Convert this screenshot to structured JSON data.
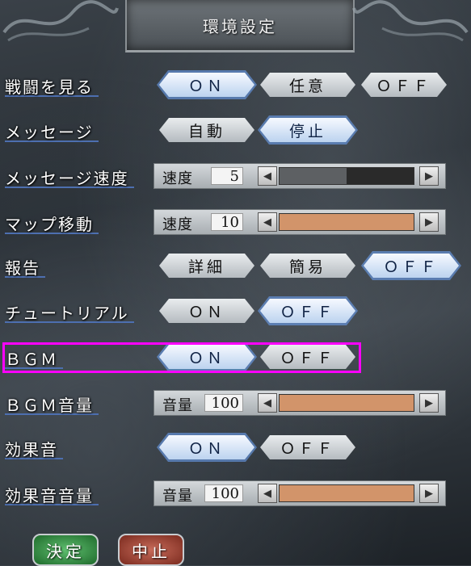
{
  "title": "環境設定",
  "colors": {
    "highlight": "#ff00ff",
    "slider_fill": "#d2946a",
    "slider_gray": "#5d6063"
  },
  "rows": [
    {
      "label": "戦闘を見る",
      "options": [
        "ＯＮ",
        "任意",
        "ＯＦＦ"
      ],
      "selected": 0
    },
    {
      "label": "メッセージ",
      "options": [
        "自動",
        "停止"
      ],
      "selected": 1
    },
    {
      "label": "メッセージ速度",
      "slider_label": "速度",
      "value": "5",
      "fill": 0.5
    },
    {
      "label": "マップ移動",
      "slider_label": "速度",
      "value": "10",
      "fill": 1.0
    },
    {
      "label": "報告",
      "options": [
        "詳細",
        "簡易",
        "ＯＦＦ"
      ],
      "selected": 2
    },
    {
      "label": "チュートリアル",
      "options": [
        "ＯＮ",
        "ＯＦＦ"
      ],
      "selected": 1
    },
    {
      "label": "ＢＧＭ",
      "options": [
        "ＯＮ",
        "ＯＦＦ"
      ],
      "selected": 0
    },
    {
      "label": "ＢＧＭ音量",
      "slider_label": "音量",
      "value": "100",
      "fill": 1.0
    },
    {
      "label": "効果音",
      "options": [
        "ＯＮ",
        "ＯＦＦ"
      ],
      "selected": 0
    },
    {
      "label": "効果音音量",
      "slider_label": "音量",
      "value": "100",
      "fill": 1.0
    }
  ],
  "footer": {
    "ok_label": "決定",
    "cancel_label": "中止"
  }
}
